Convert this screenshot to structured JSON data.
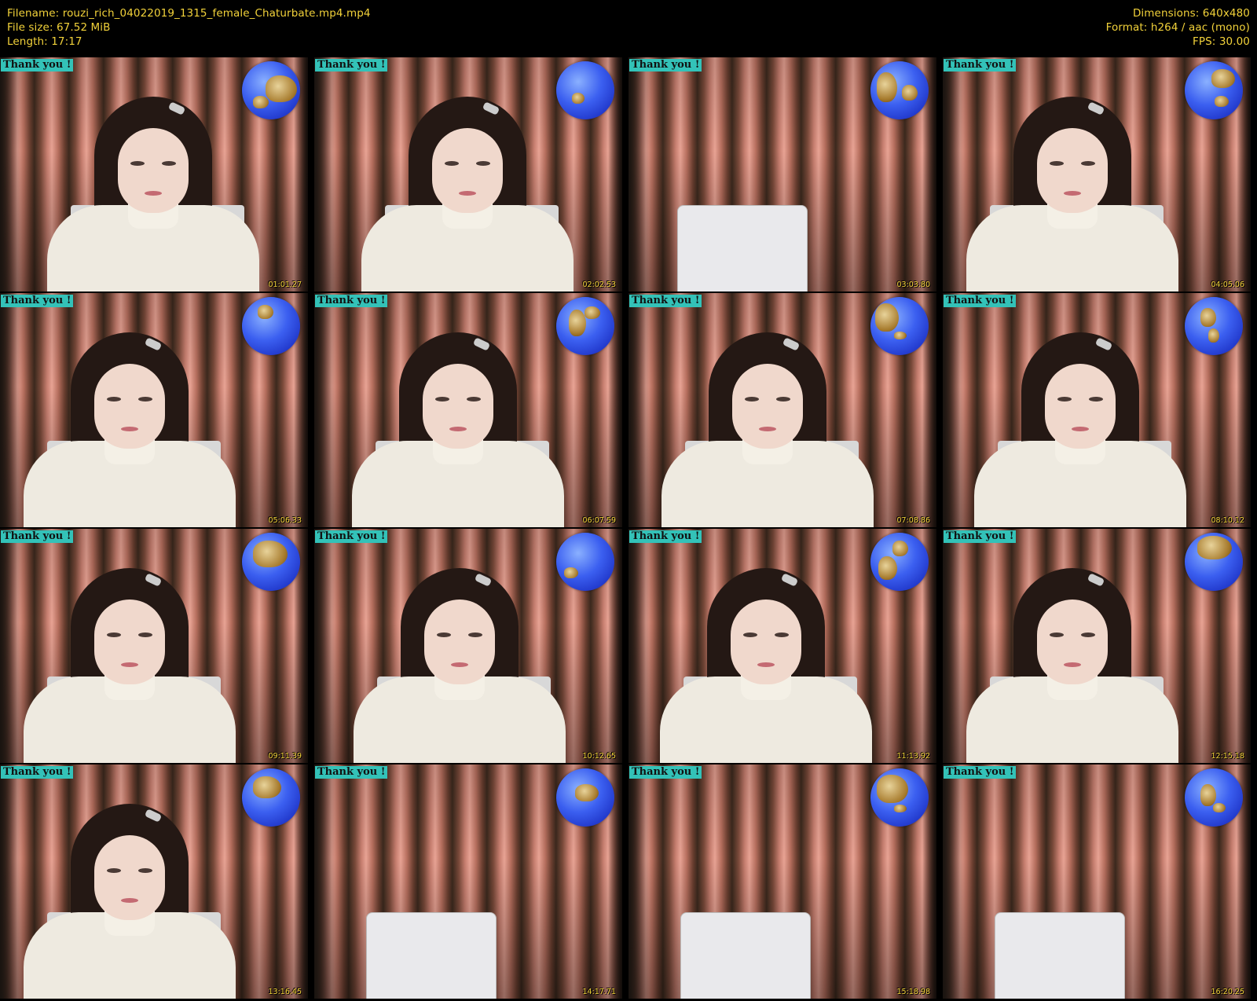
{
  "header": {
    "filename": "Filename: rouzi_rich_04022019_1315_female_Chaturbate.mp4.mp4",
    "filesize": "File size: 67.52 MiB",
    "length": "Length: 17:17",
    "dimensions": "Dimensions: 640x480",
    "format": "Format: h264 / aac (mono)",
    "fps": "FPS: 30.00"
  },
  "overlay_text": "Thank you !",
  "colors": {
    "meta_text": "#f2d23a",
    "badge_bg": "#33c2b8",
    "globe": "#3b5ff0"
  },
  "thumbnails": [
    {
      "timestamp": "01:01.27",
      "subject": "person"
    },
    {
      "timestamp": "02:02.53",
      "subject": "person"
    },
    {
      "timestamp": "03:03.80",
      "subject": "laptop"
    },
    {
      "timestamp": "04:05.06",
      "subject": "person"
    },
    {
      "timestamp": "05:06.33",
      "subject": "person"
    },
    {
      "timestamp": "06:07.59",
      "subject": "person"
    },
    {
      "timestamp": "07:08.86",
      "subject": "person"
    },
    {
      "timestamp": "08:10.12",
      "subject": "person"
    },
    {
      "timestamp": "09:11.39",
      "subject": "person"
    },
    {
      "timestamp": "10:12.65",
      "subject": "person"
    },
    {
      "timestamp": "11:13.92",
      "subject": "person"
    },
    {
      "timestamp": "12:15.18",
      "subject": "person"
    },
    {
      "timestamp": "13:16.45",
      "subject": "person"
    },
    {
      "timestamp": "14:17.71",
      "subject": "laptop"
    },
    {
      "timestamp": "15:18.98",
      "subject": "laptop"
    },
    {
      "timestamp": "16:20.25",
      "subject": "laptop"
    }
  ]
}
